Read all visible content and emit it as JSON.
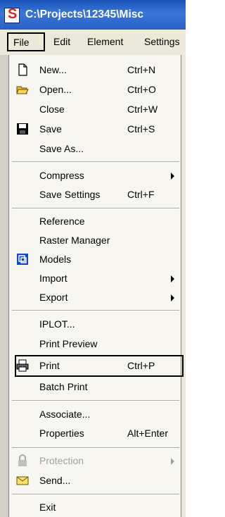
{
  "window": {
    "title": "C:\\Projects\\12345\\Misc",
    "app_icon": "microstation-icon"
  },
  "menubar": {
    "items": [
      {
        "label": "File"
      },
      {
        "label": "Edit"
      },
      {
        "label": "Element"
      },
      {
        "label": "Settings"
      }
    ]
  },
  "file_menu": {
    "items": [
      {
        "label": "New...",
        "shortcut": "Ctrl+N",
        "icon": "new-document-icon"
      },
      {
        "label": "Open...",
        "shortcut": "Ctrl+O",
        "icon": "open-folder-icon"
      },
      {
        "label": "Close",
        "shortcut": "Ctrl+W"
      },
      {
        "label": "Save",
        "shortcut": "Ctrl+S",
        "icon": "save-icon"
      },
      {
        "label": "Save As..."
      },
      {
        "label": "Compress",
        "submenu": true
      },
      {
        "label": "Save Settings",
        "shortcut": "Ctrl+F"
      },
      {
        "label": "Reference"
      },
      {
        "label": "Raster Manager"
      },
      {
        "label": "Models",
        "icon": "models-icon"
      },
      {
        "label": "Import",
        "submenu": true
      },
      {
        "label": "Export",
        "submenu": true
      },
      {
        "label": "IPLOT..."
      },
      {
        "label": "Print Preview"
      },
      {
        "label": "Print",
        "shortcut": "Ctrl+P",
        "icon": "printer-icon",
        "highlighted": true
      },
      {
        "label": "Batch Print"
      },
      {
        "label": "Associate..."
      },
      {
        "label": "Properties",
        "shortcut": "Alt+Enter"
      },
      {
        "label": "Protection",
        "submenu": true,
        "disabled": true,
        "icon": "lock-icon"
      },
      {
        "label": "Send...",
        "icon": "mail-icon"
      },
      {
        "label": "Exit"
      }
    ]
  }
}
